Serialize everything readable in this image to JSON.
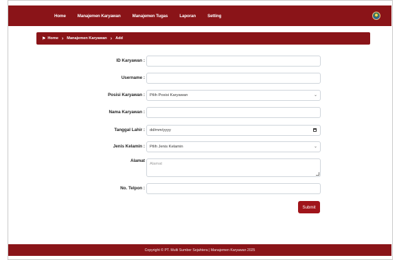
{
  "nav": {
    "items": [
      "Home",
      "Manajemen Karyawan",
      "Manajemen Tugas",
      "Laporan",
      "Setting"
    ]
  },
  "breadcrumb": {
    "home": "Home",
    "section": "Manajemen Karyawan",
    "current": "Add"
  },
  "form": {
    "id_label": "ID Karyawan :",
    "id_value": "",
    "username_label": "Username :",
    "username_value": "",
    "posisi_label": "Posisi Karyawan :",
    "posisi_selected": "Pilih Posisi Karyawan",
    "nama_label": "Nama Karyawan :",
    "nama_value": "",
    "tgl_label": "Tanggal Lahir :",
    "tgl_value": "dd/mm/yyyy",
    "jk_label": "Jenis Kelamin :",
    "jk_selected": "Pilih Jenis Kelamin",
    "alamat_label": "Alamat",
    "alamat_placeholder": "Alamat",
    "telp_label": "No. Telpon :",
    "telp_value": "",
    "submit_label": "Submit"
  },
  "footer": {
    "text": "Copyright © PT. Multi Sumber Sejahtera | Manajemen Karyawan 2025"
  },
  "colors": {
    "brand": "#8a1418",
    "button": "#a0141a"
  }
}
